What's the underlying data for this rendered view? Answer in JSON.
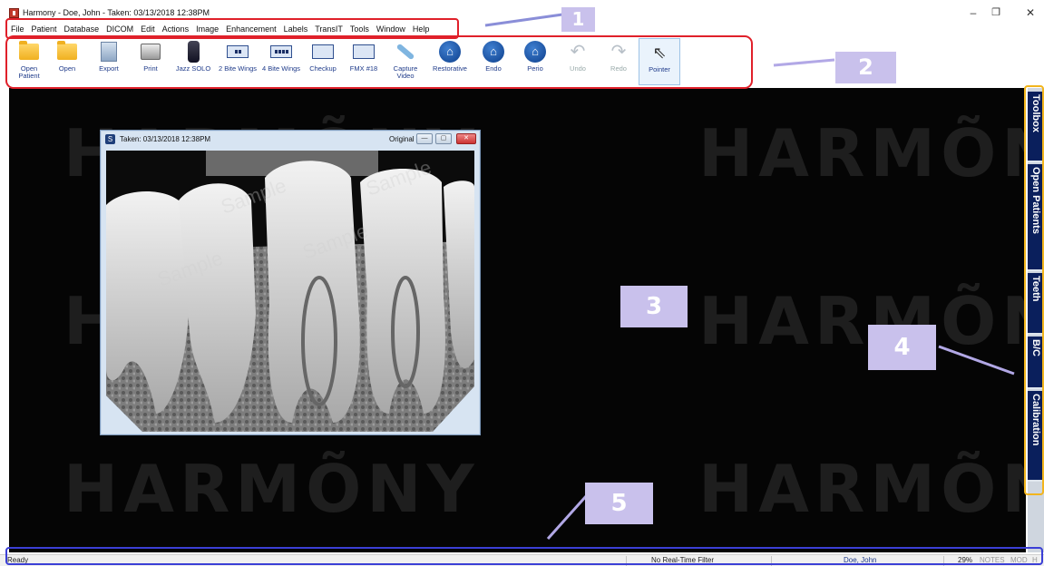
{
  "window": {
    "title": "Harmony - Doe, John - Taken: 03/13/2018  12:38PM",
    "minimize": "–",
    "restore": "❐",
    "close": "✕"
  },
  "menu": [
    "File",
    "Patient",
    "Database",
    "DICOM",
    "Edit",
    "Actions",
    "Image",
    "Enhancement",
    "Labels",
    "TransIT",
    "Tools",
    "Window",
    "Help"
  ],
  "toolbar": {
    "open_patient": "Open\nPatient",
    "open": "Open",
    "export": "Export",
    "print": "Print",
    "jazz_solo": "Jazz SOLO",
    "two_bite_wings": "2 Bite Wings",
    "four_bite_wings": "4 Bite Wings",
    "checkup": "Checkup",
    "fmx18": "FMX #18",
    "capture_video": "Capture\nVideo",
    "restorative": "Restorative",
    "endo": "Endo",
    "perio": "Perio",
    "undo": "Undo",
    "redo": "Redo",
    "pointer": "Pointer"
  },
  "workspace": {
    "watermark": "HARMÕNY"
  },
  "image_window": {
    "icon_letter": "S",
    "title": "Taken: 03/13/2018  12:38PM",
    "view_mode": "Original",
    "sample_text": "Sample"
  },
  "right_dock": [
    {
      "label": "Toolbox",
      "icon": "wrench-icon"
    },
    {
      "label": "Open Patients",
      "icon": "person-icon"
    },
    {
      "label": "Teeth",
      "icon": "tooth-icon"
    },
    {
      "label": "B/C",
      "icon": "sun-icon"
    },
    {
      "label": "Calibration",
      "icon": "ruler-icon"
    }
  ],
  "statusbar": {
    "status": "Ready",
    "filter": "No Real-Time Filter",
    "patient": "Doe, John",
    "zoom": "29%",
    "notes": "NOTES",
    "mod": "MOD",
    "h": "H"
  },
  "callouts": [
    "1",
    "2",
    "3",
    "4",
    "5"
  ],
  "colors": {
    "menu_outline": "#e0202a",
    "toolbar_outline": "#e0202a",
    "dock_outline": "#f2b51d",
    "status_outline": "#3b3fd6",
    "badge": "#c9c1ec",
    "tool_label": "#1f3b8a",
    "dock_tab": "#0a1f5c"
  }
}
